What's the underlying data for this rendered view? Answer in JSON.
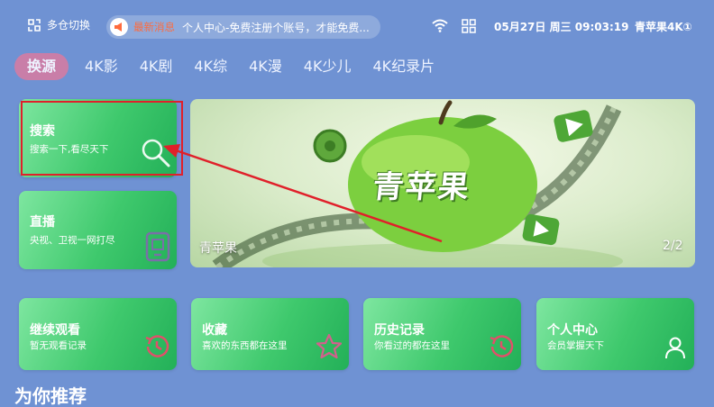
{
  "topbar": {
    "switch_label": "多仓切换",
    "news_tag": "最新消息",
    "news_text": "个人中心-免费注册个账号，才能免费...",
    "datetime": "05月27日 周三 09:03:19",
    "app_name": "青苹果4K①"
  },
  "tabs": [
    {
      "label": "换源"
    },
    {
      "label": "4K影"
    },
    {
      "label": "4K剧"
    },
    {
      "label": "4K综"
    },
    {
      "label": "4K漫"
    },
    {
      "label": "4K少儿"
    },
    {
      "label": "4K纪录片"
    }
  ],
  "search_card": {
    "title": "搜索",
    "subtitle": "搜索一下,看尽天下"
  },
  "live_card": {
    "title": "直播",
    "subtitle": "央视、卫视一网打尽"
  },
  "banner": {
    "logo_text": "青苹果",
    "caption": "青苹果",
    "page_indicator": "2/2"
  },
  "bottom_cards": [
    {
      "title": "继续观看",
      "subtitle": "暂无观看记录"
    },
    {
      "title": "收藏",
      "subtitle": "喜欢的东西都在这里"
    },
    {
      "title": "历史记录",
      "subtitle": "你看过的都在这里"
    },
    {
      "title": "个人中心",
      "subtitle": "会员掌握天下"
    }
  ],
  "section_title": "为你推荐",
  "colors": {
    "background": "#6f92d3",
    "card_green": "#3fc96d",
    "active_tab": "#c97ea8",
    "annotation_red": "#e0202a",
    "news_tag": "#ff6b3d"
  }
}
